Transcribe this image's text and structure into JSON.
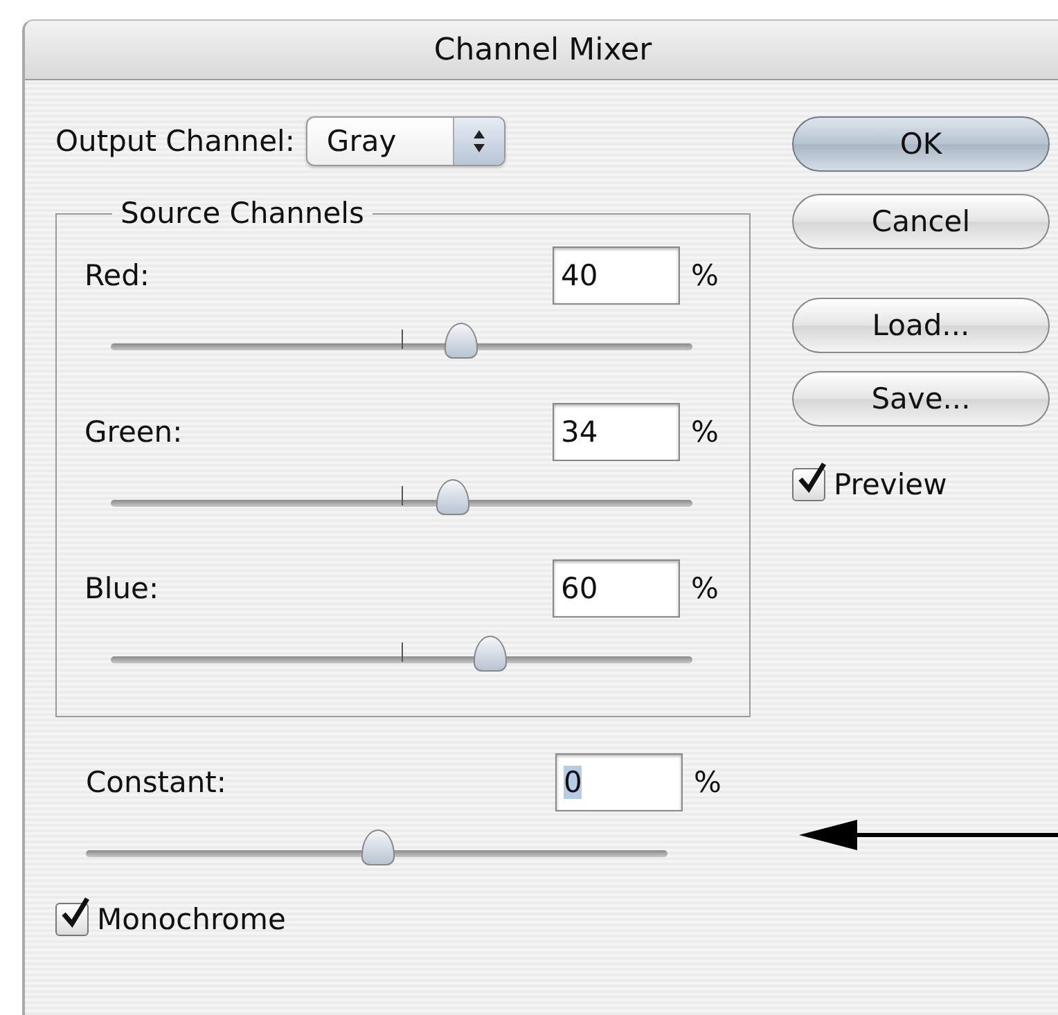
{
  "window": {
    "title": "Channel Mixer"
  },
  "output_channel": {
    "label": "Output Channel:",
    "value": "Gray"
  },
  "source_channels": {
    "title": "Source Channels",
    "channels": [
      {
        "name": "Red:",
        "value": "40",
        "unit": "%",
        "level": 0.6
      },
      {
        "name": "Green:",
        "value": "34",
        "unit": "%",
        "level": 0.585
      },
      {
        "name": "Blue:",
        "value": "60",
        "unit": "%",
        "level": 0.65
      }
    ]
  },
  "constant": {
    "name": "Constant:",
    "value": "0",
    "unit": "%",
    "level": 0.5,
    "value_selected": true
  },
  "monochrome": {
    "label": "Monochrome",
    "checked": true
  },
  "buttons": [
    {
      "label": "OK",
      "default": true
    },
    {
      "label": "Cancel",
      "default": false
    },
    {
      "label": "Load...",
      "default": false
    },
    {
      "label": "Save...",
      "default": false
    }
  ],
  "preview": {
    "label": "Preview",
    "checked": true
  }
}
